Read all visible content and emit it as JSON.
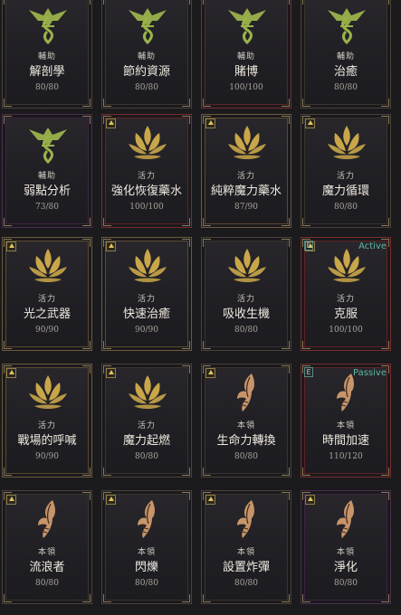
{
  "colors": {
    "assist_icon": "#9bb24a",
    "active_icon": "#c9a64a",
    "native_icon": "#c8946a",
    "state_text": "#5fb5a6"
  },
  "skills": [
    {
      "id": "r1c1",
      "category": "輔助",
      "name": "解剖學",
      "count": "80/80",
      "icon": "assist-emblem-icon",
      "frame": "normal",
      "up": false,
      "e": false,
      "state": ""
    },
    {
      "id": "r1c2",
      "category": "輔助",
      "name": "節約資源",
      "count": "80/80",
      "icon": "assist-emblem-icon",
      "frame": "normal",
      "up": false,
      "e": false,
      "state": ""
    },
    {
      "id": "r1c3",
      "category": "輔助",
      "name": "賭博",
      "count": "100/100",
      "icon": "assist-emblem-icon",
      "frame": "red",
      "up": false,
      "e": false,
      "state": ""
    },
    {
      "id": "r1c4",
      "category": "輔助",
      "name": "治癒",
      "count": "80/80",
      "icon": "assist-emblem-icon",
      "frame": "normal",
      "up": false,
      "e": false,
      "state": ""
    },
    {
      "id": "r2c1",
      "category": "輔助",
      "name": "弱點分析",
      "count": "73/80",
      "icon": "assist-emblem-icon",
      "frame": "purple",
      "up": false,
      "e": false,
      "state": ""
    },
    {
      "id": "r2c2",
      "category": "活力",
      "name": "強化恢復藥水",
      "count": "100/100",
      "icon": "lotus-emblem-icon",
      "frame": "red",
      "up": true,
      "e": false,
      "state": ""
    },
    {
      "id": "r2c3",
      "category": "活力",
      "name": "純粹魔力藥水",
      "count": "87/90",
      "icon": "lotus-emblem-icon",
      "frame": "bronze",
      "up": true,
      "e": false,
      "state": ""
    },
    {
      "id": "r2c4",
      "category": "活力",
      "name": "魔力循環",
      "count": "80/80",
      "icon": "lotus-emblem-icon",
      "frame": "normal",
      "up": true,
      "e": false,
      "state": ""
    },
    {
      "id": "r3c1",
      "category": "活力",
      "name": "光之武器",
      "count": "90/90",
      "icon": "lotus-emblem-icon",
      "frame": "bronze",
      "up": true,
      "e": false,
      "state": ""
    },
    {
      "id": "r3c2",
      "category": "活力",
      "name": "快速治癒",
      "count": "90/90",
      "icon": "lotus-emblem-icon",
      "frame": "bronze",
      "up": true,
      "e": false,
      "state": ""
    },
    {
      "id": "r3c3",
      "category": "活力",
      "name": "吸收生機",
      "count": "80/80",
      "icon": "lotus-emblem-icon",
      "frame": "normal",
      "up": false,
      "e": false,
      "state": ""
    },
    {
      "id": "r3c4",
      "category": "活力",
      "name": "克服",
      "count": "100/100",
      "icon": "lotus-emblem-icon",
      "frame": "red",
      "up": true,
      "e": true,
      "state": "Active"
    },
    {
      "id": "r4c1",
      "category": "活力",
      "name": "戰場的呼喊",
      "count": "90/90",
      "icon": "lotus-emblem-icon",
      "frame": "bronze",
      "up": true,
      "e": false,
      "state": ""
    },
    {
      "id": "r4c2",
      "category": "活力",
      "name": "魔力起燃",
      "count": "80/80",
      "icon": "lotus-emblem-icon",
      "frame": "normal",
      "up": true,
      "e": false,
      "state": ""
    },
    {
      "id": "r4c3",
      "category": "本領",
      "name": "生命力轉換",
      "count": "80/80",
      "icon": "feather-emblem-icon",
      "frame": "normal",
      "up": true,
      "e": false,
      "state": ""
    },
    {
      "id": "r4c4",
      "category": "本領",
      "name": "時間加速",
      "count": "110/120",
      "icon": "feather-emblem-icon",
      "frame": "red",
      "up": false,
      "e": true,
      "state": "Passive"
    },
    {
      "id": "r5c1",
      "category": "本領",
      "name": "流浪者",
      "count": "80/80",
      "icon": "feather-emblem-icon",
      "frame": "normal",
      "up": true,
      "e": false,
      "state": ""
    },
    {
      "id": "r5c2",
      "category": "本領",
      "name": "閃爍",
      "count": "80/80",
      "icon": "feather-emblem-icon",
      "frame": "normal",
      "up": true,
      "e": false,
      "state": ""
    },
    {
      "id": "r5c3",
      "category": "本領",
      "name": "設置炸彈",
      "count": "80/80",
      "icon": "feather-emblem-icon",
      "frame": "normal",
      "up": true,
      "e": false,
      "state": ""
    },
    {
      "id": "r5c4",
      "category": "本領",
      "name": "淨化",
      "count": "80/80",
      "icon": "feather-emblem-icon",
      "frame": "purple",
      "up": true,
      "e": false,
      "state": ""
    }
  ]
}
